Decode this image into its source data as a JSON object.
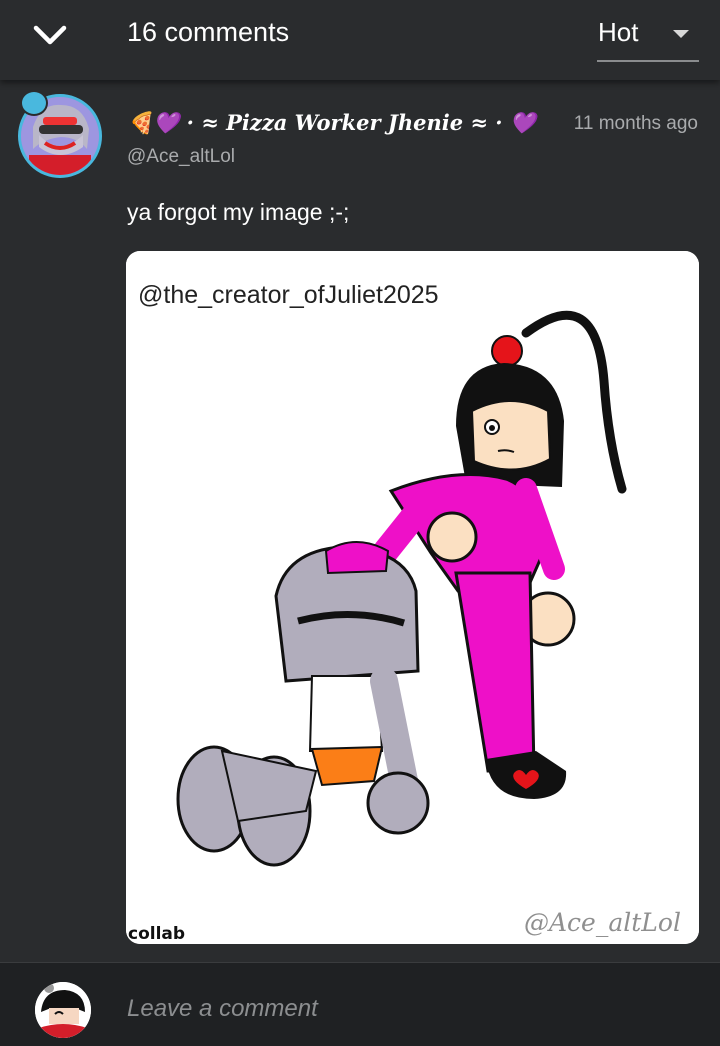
{
  "header": {
    "title": "16 comments",
    "sort_label": "Hot"
  },
  "comment": {
    "username": "🍕💜 · ≈ Pizza Worker Jhenie ≈ · 💜",
    "handle": "@Ace_altLol",
    "timestamp": "11 months ago",
    "text": "ya forgot my image ;-;",
    "attachment": {
      "credit_text": "@the_creator_ofJuliet2025",
      "corner_note": "collab",
      "signature": "@Ace_altLol"
    }
  },
  "footer": {
    "input_placeholder": "Leave a comment"
  },
  "colors": {
    "background": "#2a2c2e",
    "footer": "#1f2123",
    "avatar_ring": "#49b8de",
    "muted_text": "#a9abad"
  },
  "icons": {
    "collapse": "chevron-down-icon",
    "sort": "caret-down-icon"
  }
}
